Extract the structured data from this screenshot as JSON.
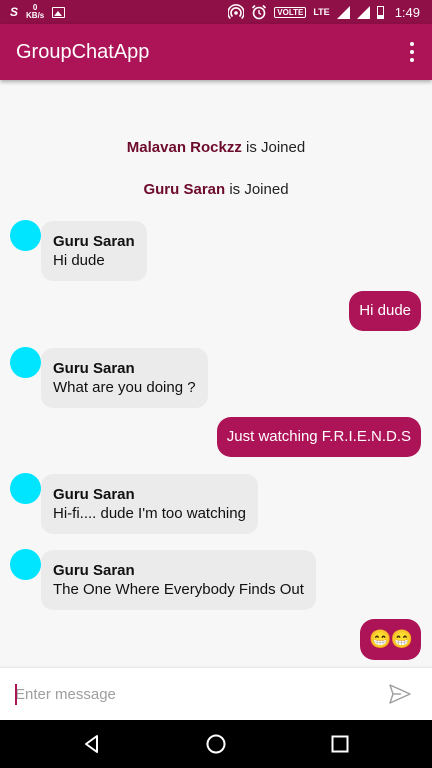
{
  "status_bar": {
    "left_indicator": "S",
    "data_speed_value": "0",
    "data_speed_unit": "KB/s",
    "volte": "VOLTE",
    "lte": "LTE",
    "time": "1:49",
    "icons": [
      "image-icon",
      "hotspot-icon",
      "alarm-icon",
      "signal-icon",
      "battery-icon"
    ]
  },
  "app_bar": {
    "title": "GroupChatApp"
  },
  "chat": {
    "joined": [
      {
        "name": "Malavan Rockzz",
        "text": "is Joined"
      },
      {
        "name": "Guru Saran",
        "text": "is Joined"
      }
    ],
    "messages": [
      {
        "direction": "incoming",
        "sender": "Guru Saran",
        "text": "Hi dude"
      },
      {
        "direction": "outgoing",
        "text": "Hi dude"
      },
      {
        "direction": "incoming",
        "sender": "Guru Saran",
        "text": "What are you doing ?"
      },
      {
        "direction": "outgoing",
        "text": "Just watching F.R.I.E.N.D.S"
      },
      {
        "direction": "incoming",
        "sender": "Guru Saran",
        "text": "Hi-fi.... dude I'm too watching"
      },
      {
        "direction": "incoming",
        "sender": "Guru Saran",
        "text": "The One Where Everybody Finds Out"
      },
      {
        "direction": "outgoing",
        "text": "😁😁"
      }
    ]
  },
  "input": {
    "placeholder": "Enter message"
  },
  "colors": {
    "status_bar": "#8f0f47",
    "primary": "#ad1457",
    "avatar": "#00e5ff",
    "incoming_bubble": "#ebebeb",
    "joined_name": "#6d0b2c"
  }
}
